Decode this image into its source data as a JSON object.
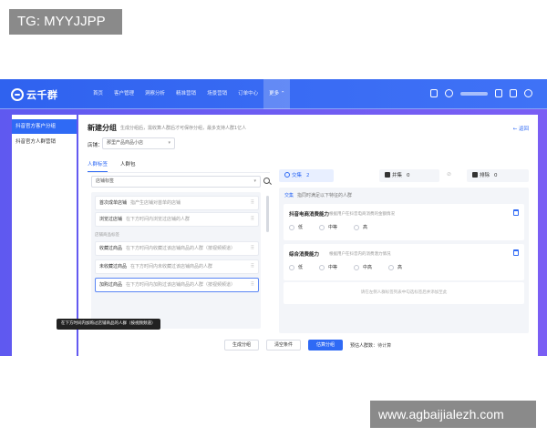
{
  "watermarks": {
    "top": "TG: MYYJJPP",
    "bottom": "www.agbaijialezh.com"
  },
  "app": {
    "logo_text": "云千群"
  },
  "nav": {
    "items": [
      {
        "label": "首页",
        "active": false
      },
      {
        "label": "客户管理",
        "active": false
      },
      {
        "label": "洞察分析",
        "active": false
      },
      {
        "label": "精准营销",
        "active": false
      },
      {
        "label": "场景营销",
        "active": false
      },
      {
        "label": "订单中心",
        "active": false
      },
      {
        "label": "更多 ⌃",
        "active": true
      }
    ]
  },
  "sidebar": {
    "items": [
      {
        "label": "抖音官方客户分组",
        "active": true
      },
      {
        "label": "抖音官方人群营销",
        "active": false
      }
    ]
  },
  "main": {
    "title": "新建分组",
    "subtitle": "生成分组后，需收算人群后才可保存分组，最多支持人群1亿人",
    "back": "← 返回",
    "store_label": "店铺：",
    "store_value": "那里产品商品小店",
    "tabs": [
      {
        "label": "人群标签",
        "active": true
      },
      {
        "label": "人群包",
        "active": false
      }
    ]
  },
  "left": {
    "search_value": "店铺标签",
    "tags_top": [
      {
        "name": "首次成单店铺",
        "desc": "指产生店铺对首单的店铺"
      },
      {
        "name": "浏览过店铺",
        "desc": "在下方时间内浏览过店铺的人群"
      }
    ],
    "group_label": "店铺商品标签",
    "tags_bottom": [
      {
        "name": "收藏过商品",
        "desc": "在下方时间内收藏过该店铺商品的人群（按视频频道）"
      },
      {
        "name": "未收藏过商品",
        "desc": "在下方时间内未收藏过该店铺商品的人群"
      },
      {
        "name": "加购过商品",
        "desc": "在下方时间内加购过该店铺商品的人群（按视频频道）"
      }
    ],
    "tooltip": "在下方时间内加购过店铺商品的人群（按视频频道）"
  },
  "ops": [
    {
      "label": "交集",
      "count": "2"
    },
    {
      "label": "并集",
      "count": "0"
    },
    {
      "label": "排除",
      "count": "0"
    }
  ],
  "right": {
    "head_hl": "交集",
    "head_desc": "指同时满足以下特征的人群",
    "cards": [
      {
        "title": "抖音电商消费能力",
        "desc": "根据用户在抖音电商消费的金额情况",
        "options": [
          "低",
          "中等",
          "高"
        ]
      },
      {
        "title": "综合消费能力",
        "desc": "根据用户在抖音内的消费潜力情况",
        "options": [
          "低",
          "中等",
          "中高",
          "高"
        ]
      }
    ],
    "empty_text": "请在左侧人群标签列表中勾选标签后并添加至此"
  },
  "footer": {
    "generate_label": "生成分组",
    "clear_label": "清空条件",
    "calc_label": "估算分组",
    "note_label": "预估人群数：",
    "note_value": "待计算"
  }
}
